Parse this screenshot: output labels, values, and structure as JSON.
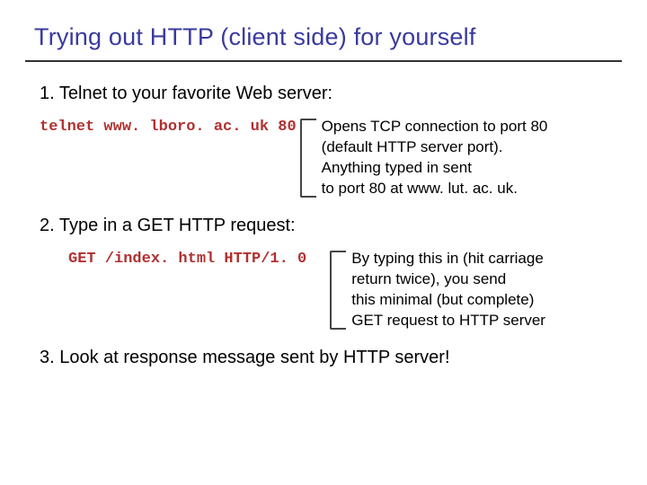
{
  "title": "Trying out HTTP (client side) for yourself",
  "step1": "1. Telnet to your favorite Web server:",
  "cmd1": "telnet www. lboro. ac. uk 80",
  "note1_l1": "Opens TCP connection to port 80",
  "note1_l2": "(default HTTP server port).",
  "note1_l3": "Anything typed in sent",
  "note1_l4": "to port 80 at www. lut. ac. uk.",
  "step2": "2. Type in a GET HTTP request:",
  "cmd2": "GET /index. html HTTP/1. 0",
  "note2_l1": "By typing this in (hit carriage",
  "note2_l2": "return twice), you send",
  "note2_l3": "this minimal (but complete)",
  "note2_l4": "GET request to HTTP server",
  "step3": "3. Look at response message sent by HTTP server!"
}
